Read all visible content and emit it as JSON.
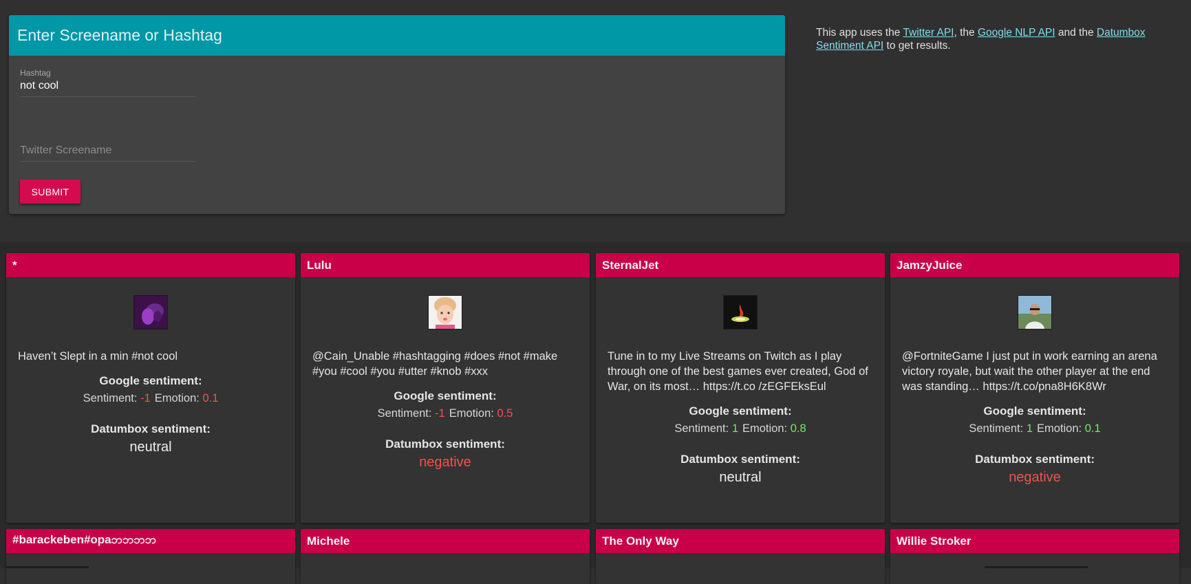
{
  "form": {
    "header": "Enter Screename or Hashtag",
    "hashtag_label": "Hashtag",
    "hashtag_value": "not cool",
    "screenname_placeholder": "Twitter Screename",
    "submit_label": "SUBMIT"
  },
  "info": {
    "prefix": "This app uses the ",
    "link1": "Twitter API",
    "sep1": ", the ",
    "link2": "Google NLP API",
    "sep2": " and the ",
    "link3": "Datumbox Sentiment API",
    "suffix": " to get results."
  },
  "labels": {
    "google": "Google sentiment:",
    "sentiment": "Sentiment:",
    "emotion": "Emotion:",
    "datumbox": "Datumbox sentiment:"
  },
  "colors": {
    "negative": "#ef5350",
    "positive": "#69f063",
    "neutral": "#eeeeee",
    "header_teal": "#0097a7",
    "accent_pink": "#c90048"
  },
  "cards": [
    {
      "name": "*",
      "tweet": "Haven’t Slept in a min #not cool",
      "sentiment": "-1",
      "emotion": "0.1",
      "datumbox": "neutral"
    },
    {
      "name": "Lulu",
      "tweet": "@Cain_Unable #hashtagging #does #not #make #you #cool #you #utter #knob #xxx",
      "sentiment": "-1",
      "emotion": "0.5",
      "datumbox": "negative"
    },
    {
      "name": "SternalJet",
      "tweet": "Tune in to my Live Streams on Twitch as I play through one of the best games ever created, God of War, on its most… https://t.co /zEGFEksEul",
      "sentiment": "1",
      "emotion": "0.8",
      "datumbox": "neutral"
    },
    {
      "name": "JamzyJuice",
      "tweet": "@FortniteGame I just put in work earning an arena victory royale, but wait the other player at the end was standing… https://t.co/pna8H6K8Wr",
      "sentiment": "1",
      "emotion": "0.1",
      "datumbox": "negative"
    }
  ],
  "next_cards": [
    "#barackeben#opaဘဘဘဘ",
    "Michele",
    "The Only Way",
    "Willie Stroker"
  ]
}
